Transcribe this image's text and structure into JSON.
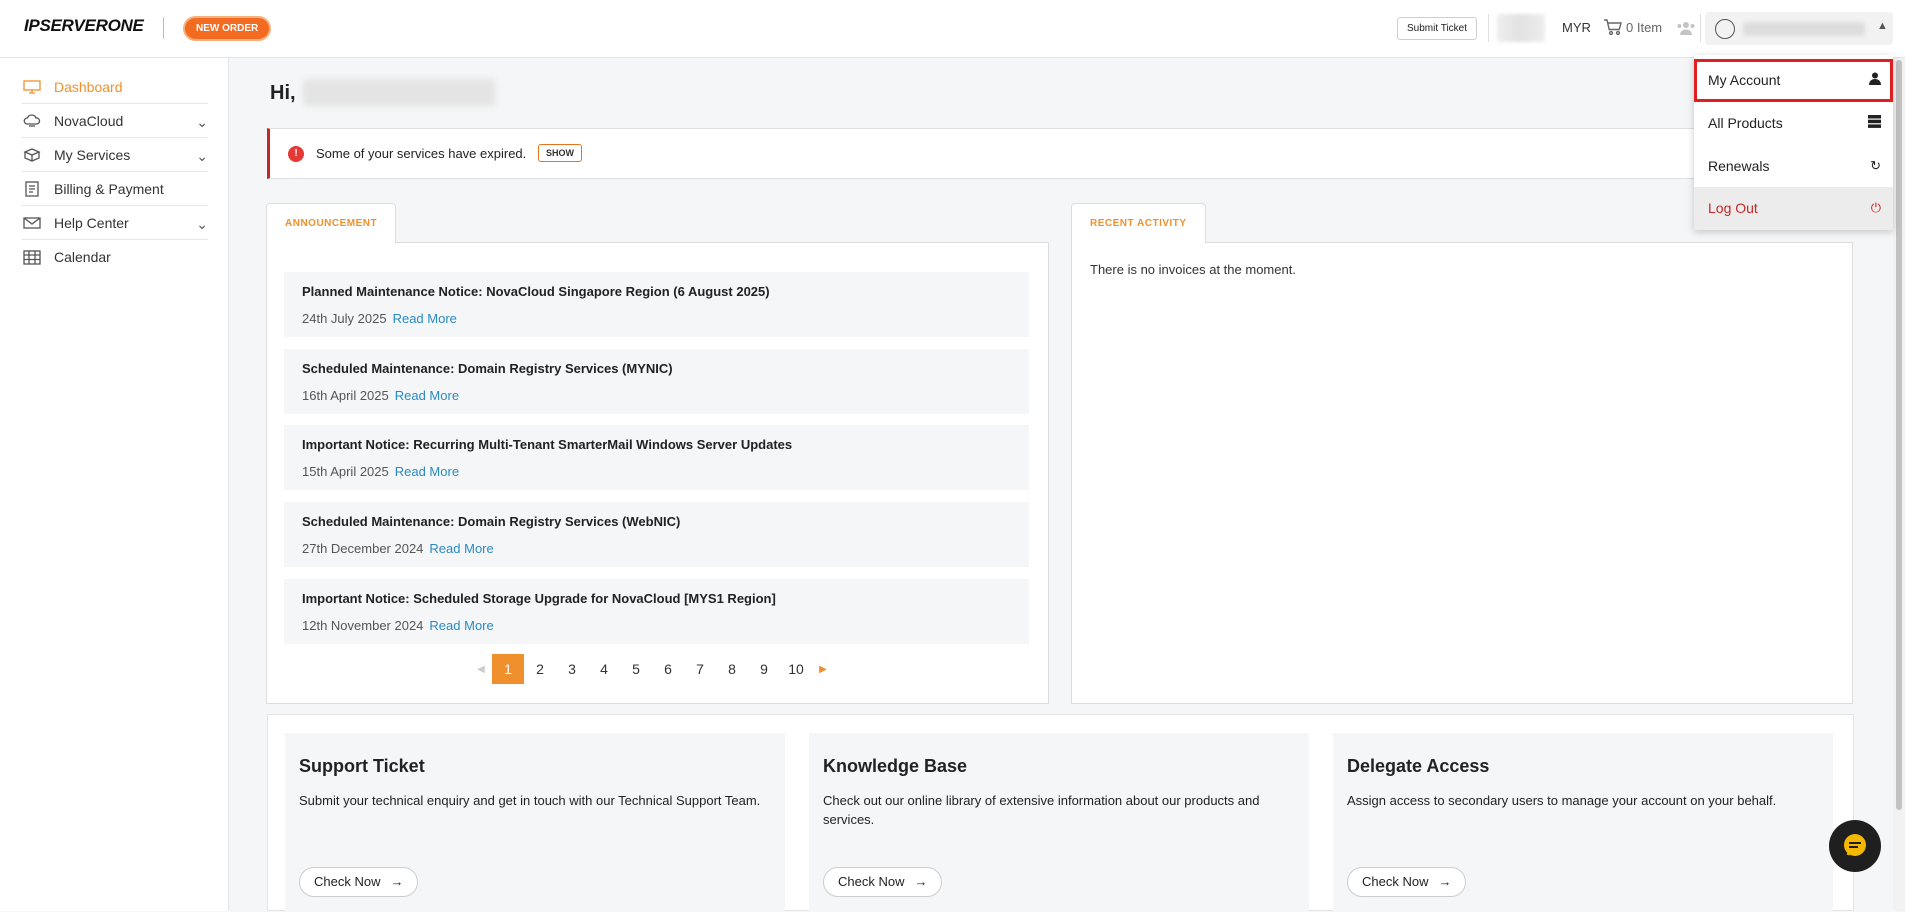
{
  "header": {
    "logo_text": "IPSERVERONE",
    "new_order_label": "NEW ORDER",
    "submit_ticket_label": "Submit Ticket",
    "currency": "MYR",
    "cart_label": "0 Item"
  },
  "sidebar": {
    "items": [
      {
        "label": "Dashboard",
        "icon": "monitor-icon"
      },
      {
        "label": "NovaCloud",
        "icon": "cloud-icon"
      },
      {
        "label": "My Services",
        "icon": "box-icon"
      },
      {
        "label": "Billing & Payment",
        "icon": "receipt-icon"
      },
      {
        "label": "Help Center",
        "icon": "mail-icon"
      },
      {
        "label": "Calendar",
        "icon": "calendar-icon"
      }
    ]
  },
  "main": {
    "greeting": "Hi,",
    "alert": {
      "message": "Some of your services have expired.",
      "show_label": "SHOW"
    },
    "announcement": {
      "tab_label": "ANNOUNCEMENT",
      "read_more_label": "Read More",
      "items": [
        {
          "title": "Planned Maintenance Notice: NovaCloud Singapore Region (6 August 2025)",
          "date": "24th July 2025"
        },
        {
          "title": "Scheduled Maintenance: Domain Registry Services (MYNIC)",
          "date": "16th April 2025"
        },
        {
          "title": "Important Notice: Recurring Multi-Tenant SmarterMail Windows Server Updates",
          "date": "15th April 2025"
        },
        {
          "title": "Scheduled Maintenance: Domain Registry Services (WebNIC)",
          "date": "27th December 2024"
        },
        {
          "title": "Important Notice: Scheduled Storage Upgrade for NovaCloud [MYS1 Region]",
          "date": "12th November 2024"
        }
      ],
      "pages": [
        "1",
        "2",
        "3",
        "4",
        "5",
        "6",
        "7",
        "8",
        "9",
        "10"
      ],
      "current_page": "1"
    },
    "recent_activity": {
      "tab_label": "RECENT ACTIVITY",
      "empty_message": "There is no invoices at the moment."
    },
    "cards": [
      {
        "title": "Support Ticket",
        "description": "Submit your technical enquiry and get in touch with our Technical Support Team.",
        "button": "Check Now"
      },
      {
        "title": "Knowledge Base",
        "description": "Check out our online library of extensive information about our products and services.",
        "button": "Check Now"
      },
      {
        "title": "Delegate Access",
        "description": "Assign access to secondary users to manage your account on your behalf.",
        "button": "Check Now"
      }
    ]
  },
  "account_menu": {
    "items": [
      {
        "label": "My Account",
        "icon": "user-icon"
      },
      {
        "label": "All Products",
        "icon": "server-icon"
      },
      {
        "label": "Renewals",
        "icon": "refresh-icon"
      },
      {
        "label": "Log Out",
        "icon": "power-icon"
      }
    ]
  },
  "colors": {
    "accent": "#f0902c",
    "new_order": "#f26b21",
    "link": "#2b8ac4",
    "danger": "#c62828",
    "highlight": "#e02020"
  }
}
